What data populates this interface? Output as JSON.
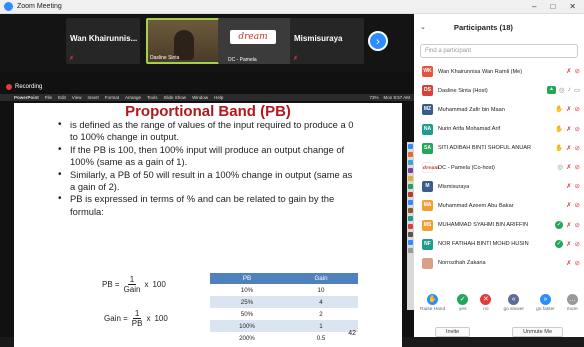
{
  "window": {
    "title": "Zoom Meeting",
    "controls": [
      "–",
      "□",
      "✕"
    ]
  },
  "gallery": {
    "tiles": [
      {
        "name": "Wan Khairunnis...",
        "caption": ""
      },
      {
        "name": "",
        "caption": "Dasline Sinta"
      },
      {
        "name": "",
        "caption": "DC - Pamela",
        "logo_text": "dream"
      },
      {
        "name": "Mismisuraya",
        "caption": ""
      }
    ],
    "next_icon": "chevron-right-icon"
  },
  "recording": {
    "label": "Recording"
  },
  "mac_menu": {
    "app": "PowerPoint",
    "items": [
      "File",
      "Edit",
      "View",
      "Insert",
      "Format",
      "Arrange",
      "Tools",
      "Slide Show",
      "Window",
      "Help"
    ],
    "status": [
      "73%",
      "Mon 9:57 AM"
    ]
  },
  "slide": {
    "title": "Proportional Band (PB)",
    "bullets": [
      "is defined as the range of values of the input required to produce a 0 to 100% change in output.",
      "If the PB is 100, then 100% input will produce an output change of 100% (same as a gain of 1).",
      "Similarly, a PB of 50 will result in a 100% change in output (same as a gain of 2).",
      "PB is expressed in terms of % and can be related to gain by the formula:"
    ],
    "formula1": {
      "lhs": "PB =",
      "num": "1",
      "den": "Gain",
      "times": "x",
      "rhs": "100"
    },
    "formula2": {
      "lhs": "Gain =",
      "num": "1",
      "den": "PB",
      "times": "x",
      "rhs": "100"
    },
    "table": {
      "headers": [
        "PB",
        "Gain"
      ],
      "rows": [
        [
          "10%",
          "10"
        ],
        [
          "25%",
          "4"
        ],
        [
          "50%",
          "2"
        ],
        [
          "100%",
          "1"
        ],
        [
          "200%",
          "0.5"
        ]
      ]
    },
    "page_number": "42"
  },
  "participants": {
    "title": "Participants (18)",
    "find_placeholder": "Find a participant",
    "list": [
      {
        "initials": "WK",
        "color": "#e8543c",
        "name": "Wan Khairunnisa Wan Ramli (Me)",
        "icons": [
          "mic-muted-icon",
          "video-off-icon"
        ]
      },
      {
        "initials": "DS",
        "color": "#d8403a",
        "name": "Dasline Sinta (Host)",
        "icons": [
          "share-icon",
          "camera-icon",
          "mic-icon",
          "video-icon"
        ]
      },
      {
        "initials": "MZ",
        "color": "#3a5b8c",
        "name": "Muhammad Zafir bin Maan",
        "icons": [
          "hand-icon",
          "mic-muted-icon",
          "video-off-icon"
        ]
      },
      {
        "initials": "NA",
        "color": "#1f9c8f",
        "name": "Nurin Arifa Mohamad Arif",
        "icons": [
          "hand-icon",
          "mic-muted-icon",
          "video-off-icon"
        ]
      },
      {
        "initials": "SA",
        "color": "#23a55a",
        "name": "SITI ADIBAH BINTI SHOFUL ANUAR",
        "icons": [
          "hand-icon",
          "mic-muted-icon",
          "video-off-icon"
        ]
      },
      {
        "initials": "dream",
        "color": "#ffffff",
        "name": "DC - Pamela (Co-host)",
        "icons": [
          "camera-icon",
          "mic-muted-icon",
          "video-off-icon"
        ]
      },
      {
        "initials": "M",
        "color": "#3a5b8c",
        "name": "Mismisuraya",
        "icons": [
          "mic-muted-icon",
          "video-off-icon"
        ]
      },
      {
        "initials": "MA",
        "color": "#f0a030",
        "name": "Muhammad Azeem Abu Bakar",
        "icons": [
          "mic-muted-icon",
          "video-off-icon"
        ]
      },
      {
        "initials": "MS",
        "color": "#f0a030",
        "name": "MUHAMMAD SYAHMI BIN ARIFFIN",
        "icons": [
          "check-icon",
          "mic-muted-icon",
          "video-off-icon"
        ]
      },
      {
        "initials": "NF",
        "color": "#1f9c8f",
        "name": "NOR FATIHAH BINTI MOHD HUSIN",
        "icons": [
          "check-icon",
          "mic-muted-icon",
          "video-off-icon"
        ]
      },
      {
        "initials": "",
        "color": "#d8a08a",
        "name": "Norrozihah Zakaria",
        "icons": [
          "mic-muted-icon",
          "video-off-icon"
        ]
      }
    ],
    "reactions": [
      {
        "label": "Raise Hand",
        "icon": "✋",
        "color": "#2d8cff"
      },
      {
        "label": "yes",
        "icon": "✓",
        "color": "#23a55a"
      },
      {
        "label": "no",
        "icon": "✕",
        "color": "#e03c3c"
      },
      {
        "label": "go slower",
        "icon": "«",
        "color": "#5a6b9c"
      },
      {
        "label": "go faster",
        "icon": "»",
        "color": "#2d8cff"
      },
      {
        "label": "more",
        "icon": "…",
        "color": "#999999"
      }
    ],
    "invite_label": "Invite",
    "unmute_label": "Unmute Me"
  }
}
